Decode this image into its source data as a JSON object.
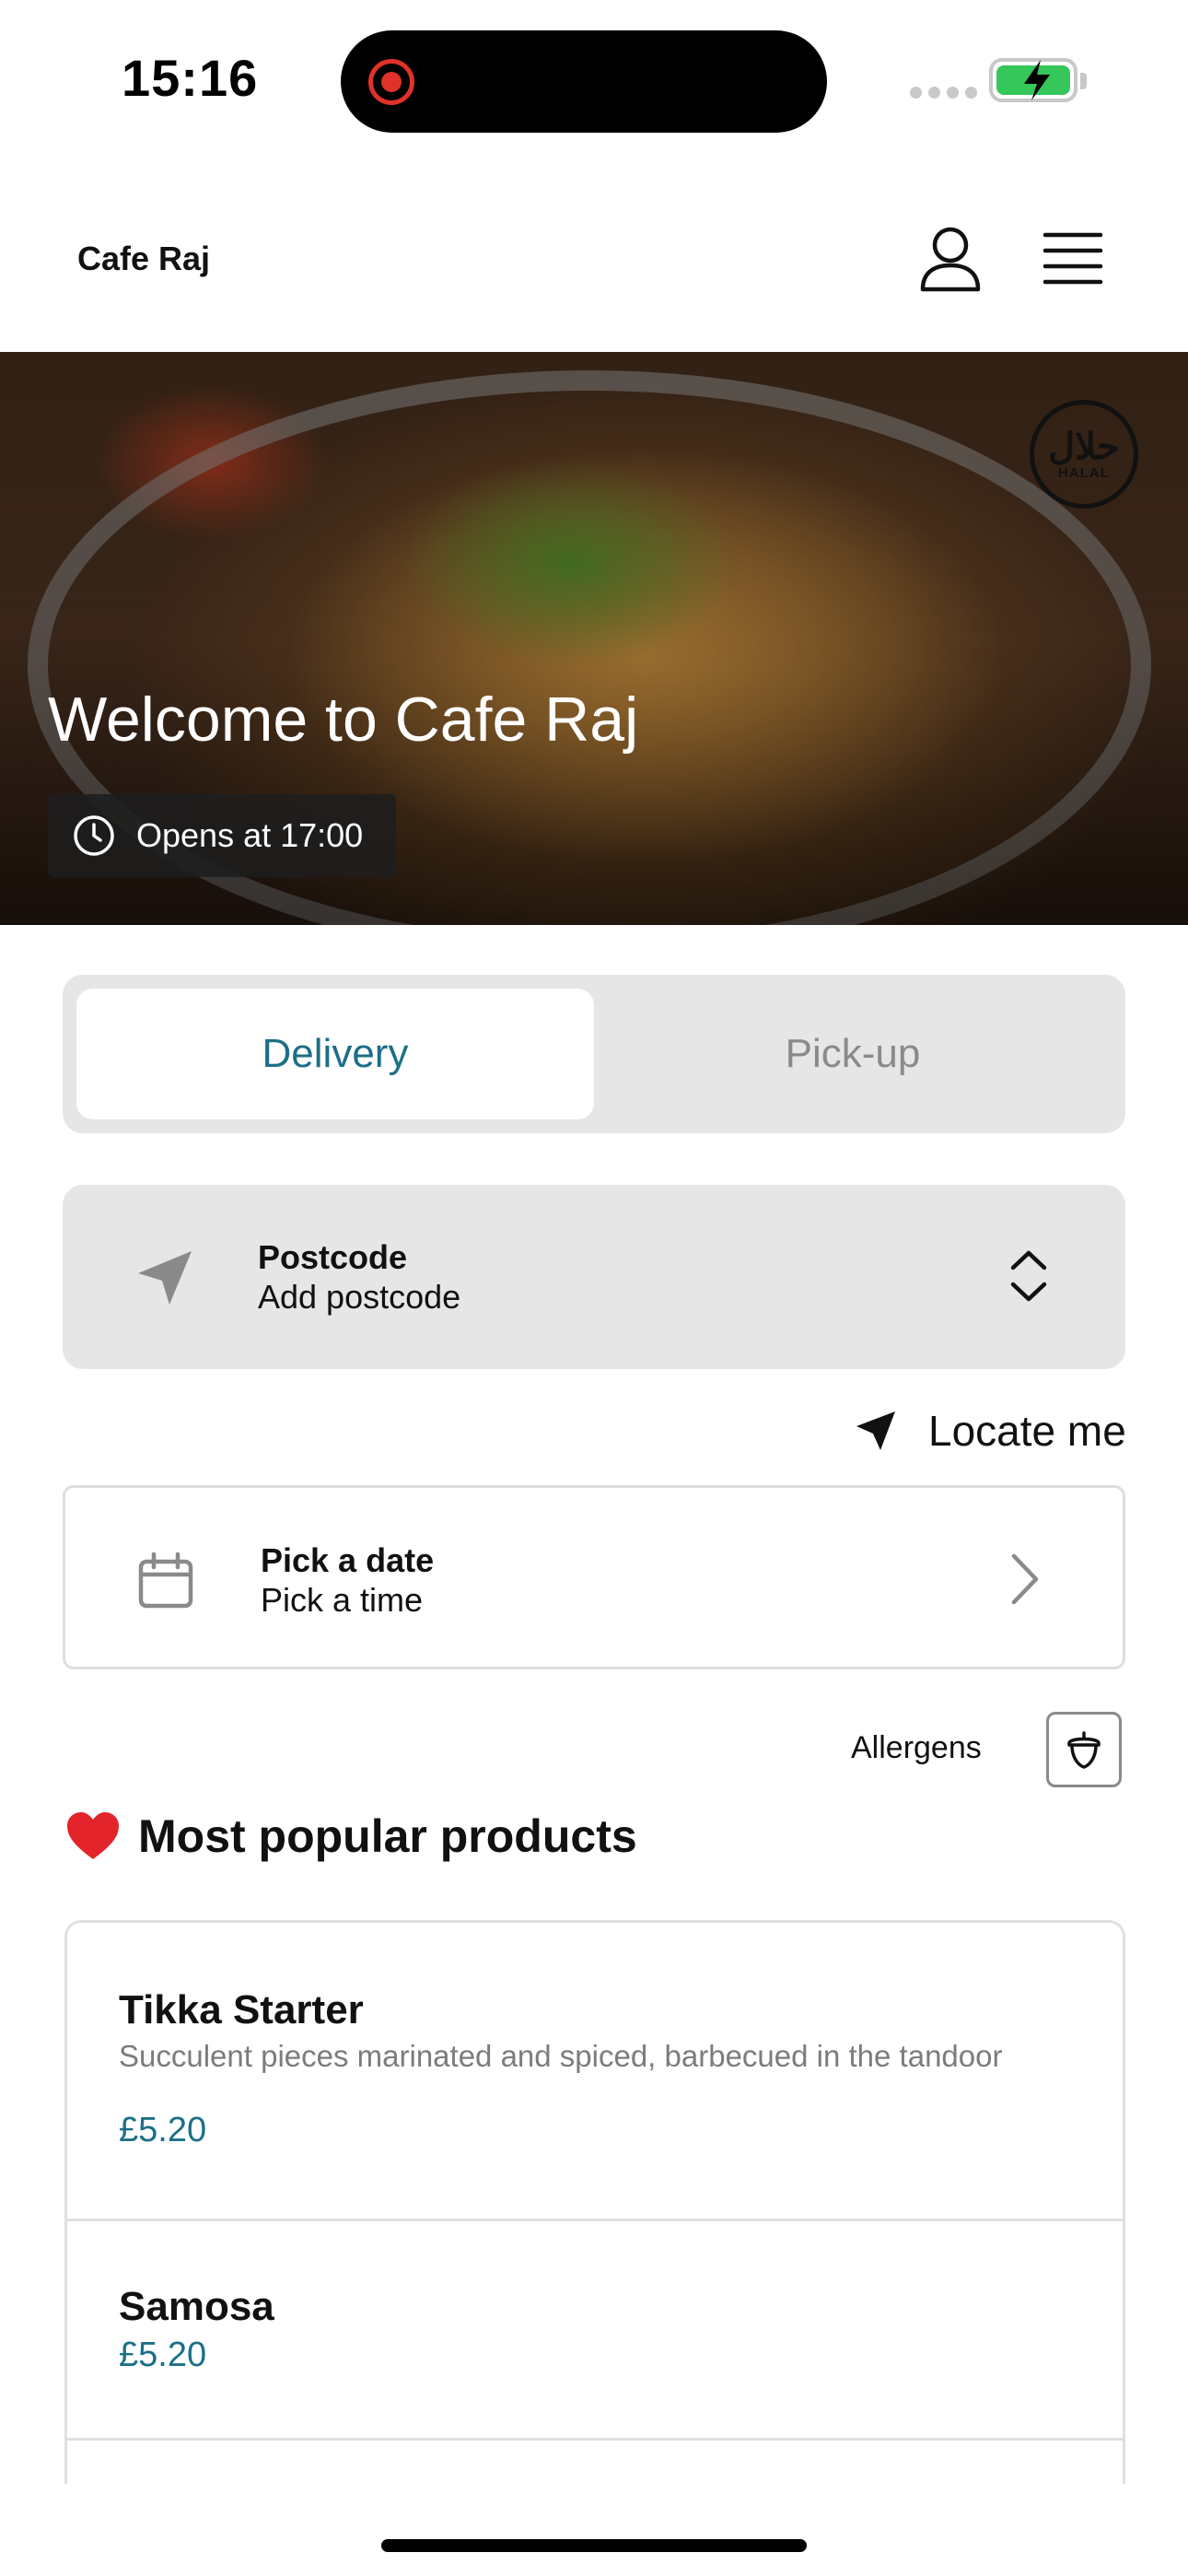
{
  "status_bar": {
    "time": "15:16"
  },
  "header": {
    "brand": "Cafe Raj"
  },
  "hero": {
    "title": "Welcome to Cafe Raj",
    "opens": "Opens at 17:00",
    "badge_arabic": "حلال",
    "badge_text": "HALAL"
  },
  "order_type": {
    "options": [
      "Delivery",
      "Pick-up"
    ],
    "selected": "Delivery"
  },
  "postcode": {
    "label": "Postcode",
    "value": "Add postcode"
  },
  "locate": {
    "label": "Locate me"
  },
  "schedule": {
    "date_label": "Pick a date",
    "time_label": "Pick a time"
  },
  "allergens": {
    "label": "Allergens"
  },
  "popular": {
    "title": "Most popular products",
    "products": [
      {
        "name": "Tikka Starter",
        "description": "Succulent pieces marinated and spiced, barbecued in the tandoor",
        "price": "£5.20"
      },
      {
        "name": "Samosa",
        "description": "",
        "price": "£5.20"
      }
    ]
  },
  "colors": {
    "accent": "#1c6f87",
    "panel": "#e6e6e6"
  }
}
